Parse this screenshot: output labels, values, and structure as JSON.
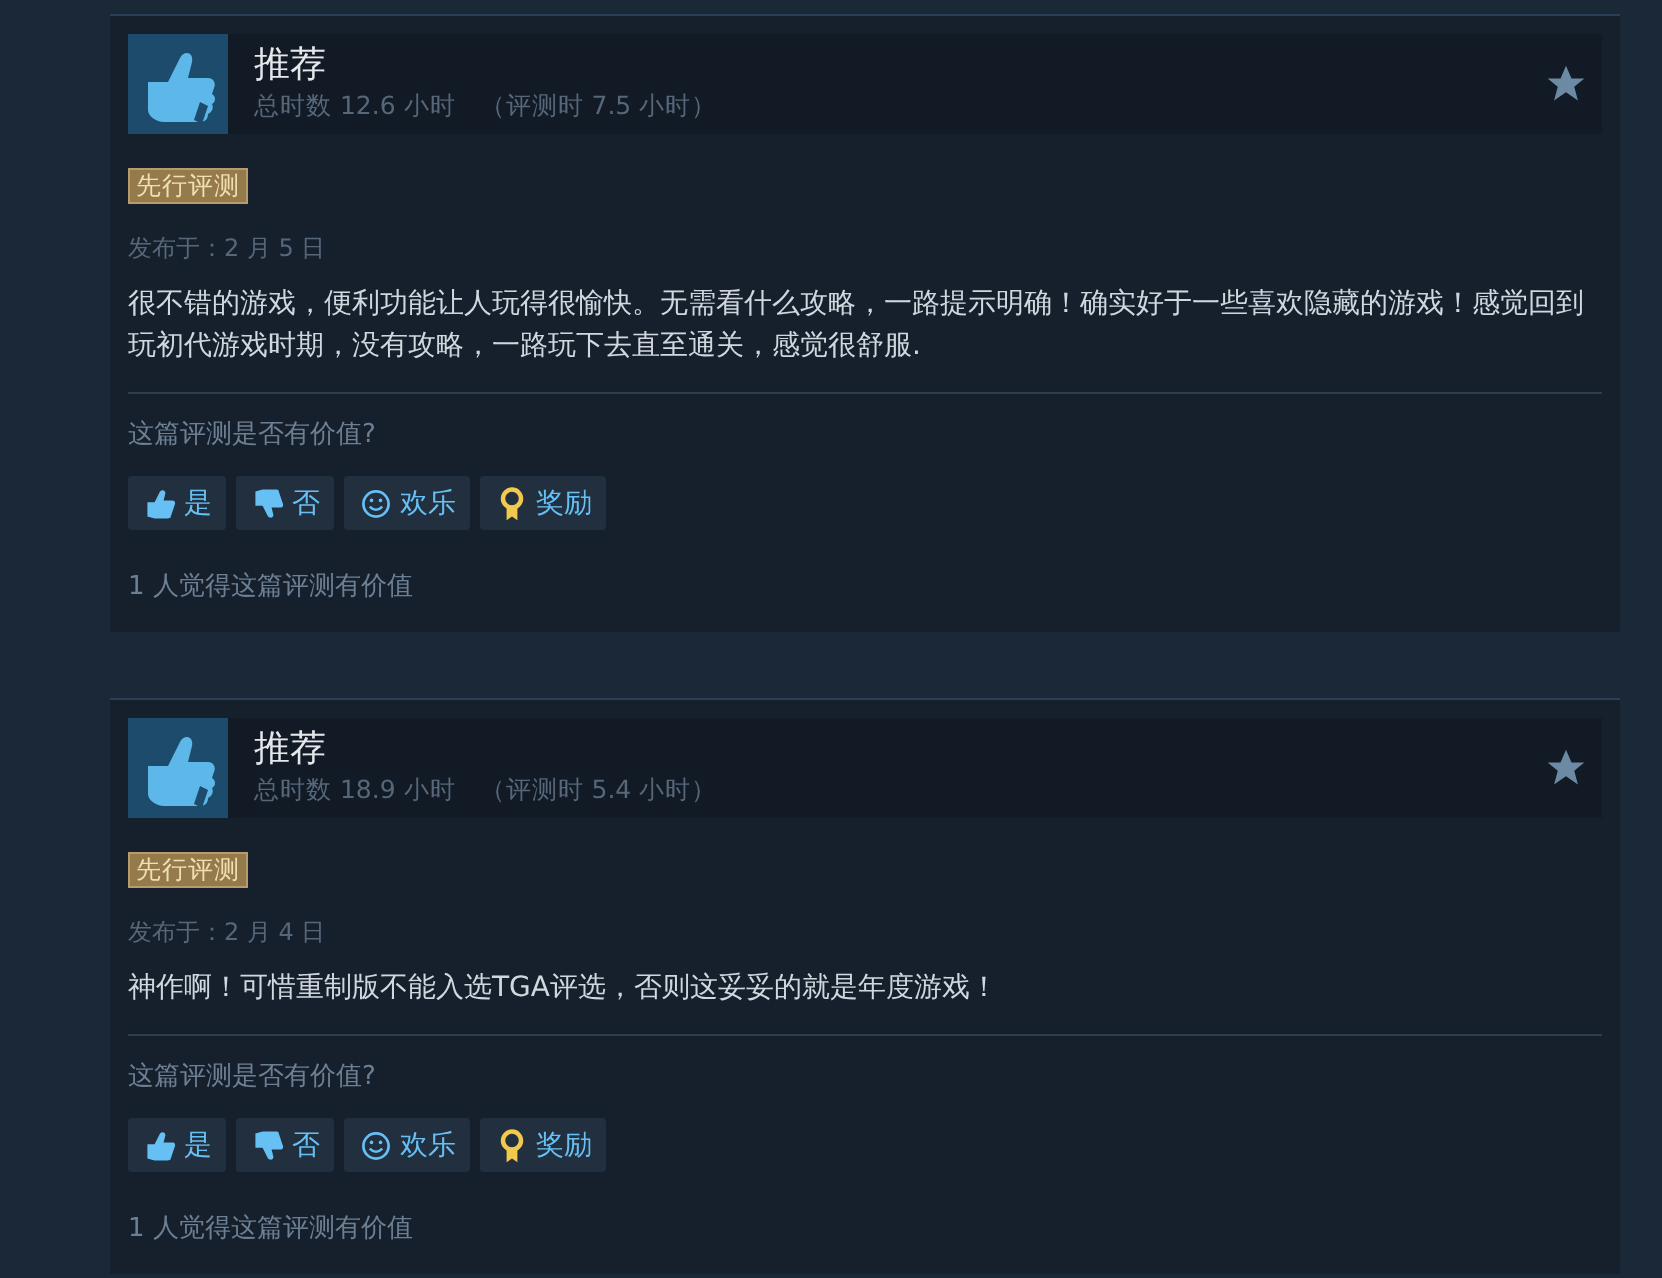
{
  "reviews": [
    {
      "verdict": "推荐",
      "hours": "总时数 12.6 小时",
      "hours_at_review": "（评测时 7.5 小时）",
      "badge": "先行评测",
      "posted": "发布于：2 月 5 日",
      "text": "很不错的游戏，便利功能让人玩得很愉快。无需看什么攻略，一路提示明确！确实好于一些喜欢隐藏的游戏！感觉回到玩初代游戏时期，没有攻略，一路玩下去直至通关，感觉很舒服.",
      "question": "这篇评测是否有价值?",
      "buttons": [
        {
          "kind": "yes",
          "label": "是"
        },
        {
          "kind": "no",
          "label": "否"
        },
        {
          "kind": "funny",
          "label": "欢乐"
        },
        {
          "kind": "award",
          "label": "奖励"
        }
      ],
      "helpful": "1 人觉得这篇评测有价值"
    },
    {
      "verdict": "推荐",
      "hours": "总时数 18.9 小时",
      "hours_at_review": "（评测时 5.4 小时）",
      "badge": "先行评测",
      "posted": "发布于：2 月 4 日",
      "text": "神作啊！可惜重制版不能入选TGA评选，否则这妥妥的就是年度游戏！",
      "question": "这篇评测是否有价值?",
      "buttons": [
        {
          "kind": "yes",
          "label": "是"
        },
        {
          "kind": "no",
          "label": "否"
        },
        {
          "kind": "funny",
          "label": "欢乐"
        },
        {
          "kind": "award",
          "label": "奖励"
        }
      ],
      "helpful": "1 人觉得这篇评测有价值"
    }
  ]
}
